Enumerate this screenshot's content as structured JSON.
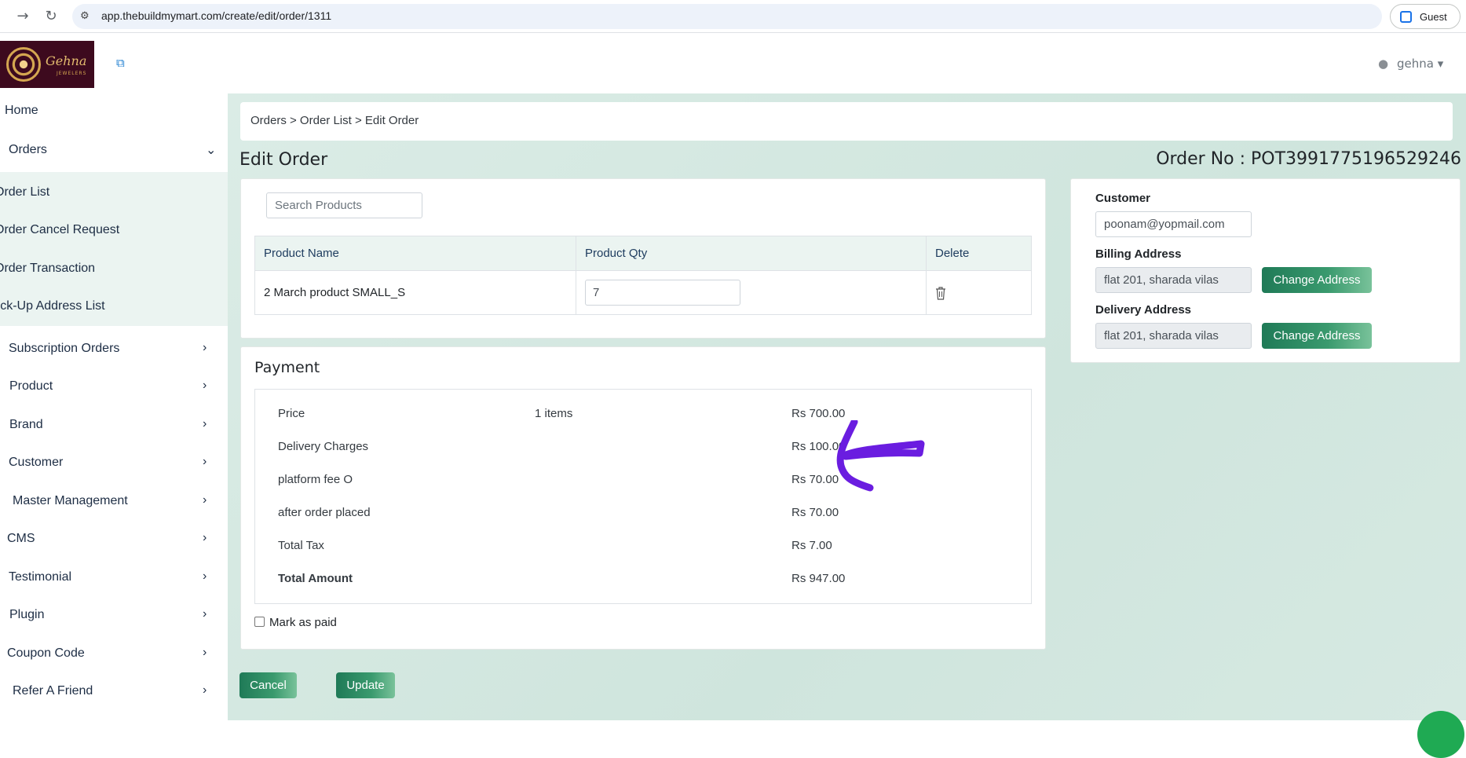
{
  "browser": {
    "url": "app.thebuildmymart.com/create/edit/order/1311",
    "profile_label": "Guest"
  },
  "header": {
    "logo_text": "Gehna",
    "logo_sub": "JEWELERS",
    "user_name": "gehna"
  },
  "sidebar": {
    "items": [
      {
        "label": "Home"
      },
      {
        "label": "Orders"
      },
      {
        "label": "Order List"
      },
      {
        "label": "Order Cancel Request"
      },
      {
        "label": "Order Transaction"
      },
      {
        "label": "Pick-Up Address List"
      },
      {
        "label": "Subscription Orders"
      },
      {
        "label": "Product"
      },
      {
        "label": "Brand"
      },
      {
        "label": "Customer"
      },
      {
        "label": "Master Management"
      },
      {
        "label": "CMS"
      },
      {
        "label": "Testimonial"
      },
      {
        "label": "Plugin"
      },
      {
        "label": "Coupon Code"
      },
      {
        "label": "Refer A Friend"
      }
    ]
  },
  "main": {
    "breadcrumb": "Orders > Order List > Edit Order",
    "title": "Edit Order",
    "order_no": "Order No : POT3991775196529246",
    "search_placeholder": "Search Products",
    "table": {
      "headers": [
        "Product Name",
        "Product Qty",
        "Delete"
      ],
      "rows": [
        {
          "name": "2 March product SMALL_S",
          "qty": "7"
        }
      ]
    },
    "payment": {
      "title": "Payment",
      "rows": [
        {
          "label": "Price",
          "middle": "1 items",
          "value": "Rs 700.00"
        },
        {
          "label": "Delivery Charges",
          "middle": "",
          "value": "Rs 100.00"
        },
        {
          "label": "platform fee O",
          "middle": "",
          "value": "Rs 70.00"
        },
        {
          "label": "after order placed",
          "middle": "",
          "value": "Rs 70.00"
        },
        {
          "label": "Total Tax",
          "middle": "",
          "value": "Rs 7.00"
        },
        {
          "label": "Total Amount",
          "middle": "",
          "value": "Rs 947.00"
        }
      ],
      "mark_paid_label": "Mark as paid"
    },
    "customer": {
      "customer_label": "Customer",
      "customer_value": "poonam@yopmail.com",
      "billing_label": "Billing Address",
      "billing_value": "flat 201, sharada vilas",
      "delivery_label": "Delivery Address",
      "delivery_value": "flat 201, sharada vilas",
      "change_address_label": "Change Address"
    },
    "buttons": {
      "cancel": "Cancel",
      "update": "Update"
    }
  },
  "colors": {
    "accent_green": "#1f7a57",
    "sidebar_active_bg": "#ebf4f1",
    "main_bg": "#d3e8e0",
    "annotation": "#6a1de0"
  }
}
